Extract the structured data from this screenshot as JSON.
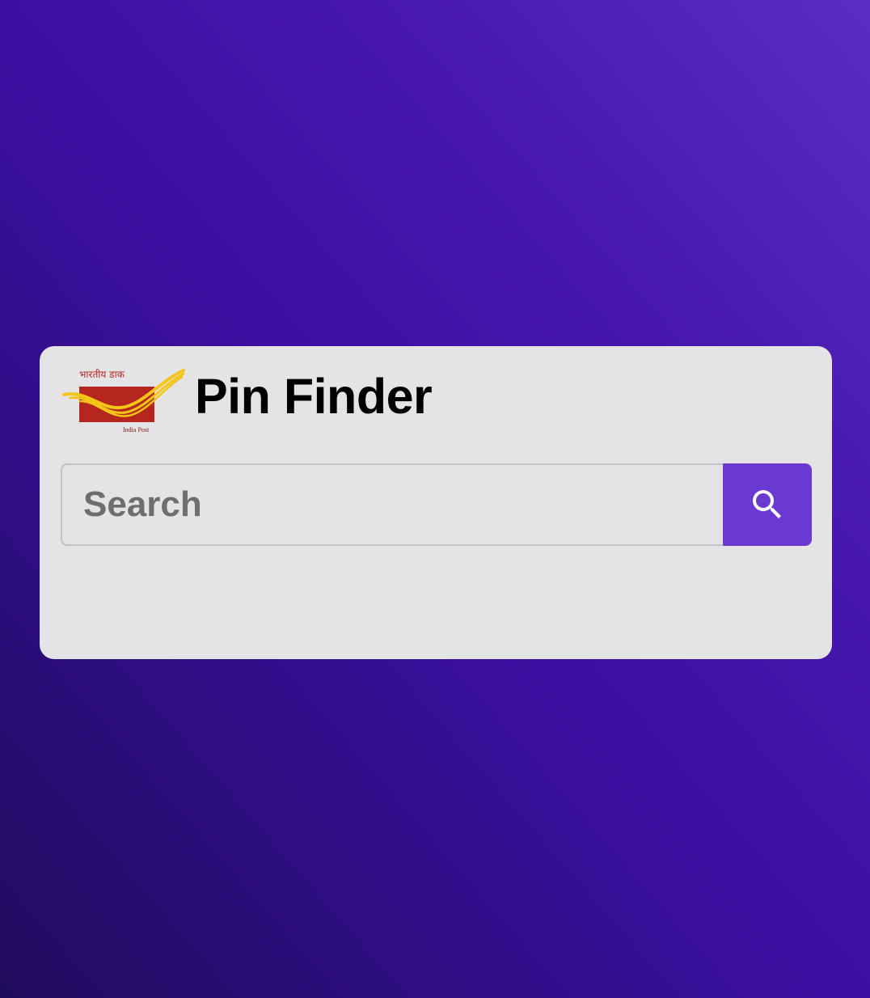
{
  "app": {
    "title": "Pin Finder",
    "logo": {
      "icon": "india-post-logo",
      "text_top": "भारतीय डाक",
      "text_bottom": "India Post"
    }
  },
  "search": {
    "placeholder": "Search",
    "value": "",
    "button_icon": "search-icon"
  },
  "colors": {
    "background_dark": "#200c5e",
    "background_light": "#5a2ec2",
    "card": "#e4e4e6",
    "accent": "#6a38d2",
    "logo_red": "#b5261e",
    "logo_yellow": "#f2c518"
  }
}
